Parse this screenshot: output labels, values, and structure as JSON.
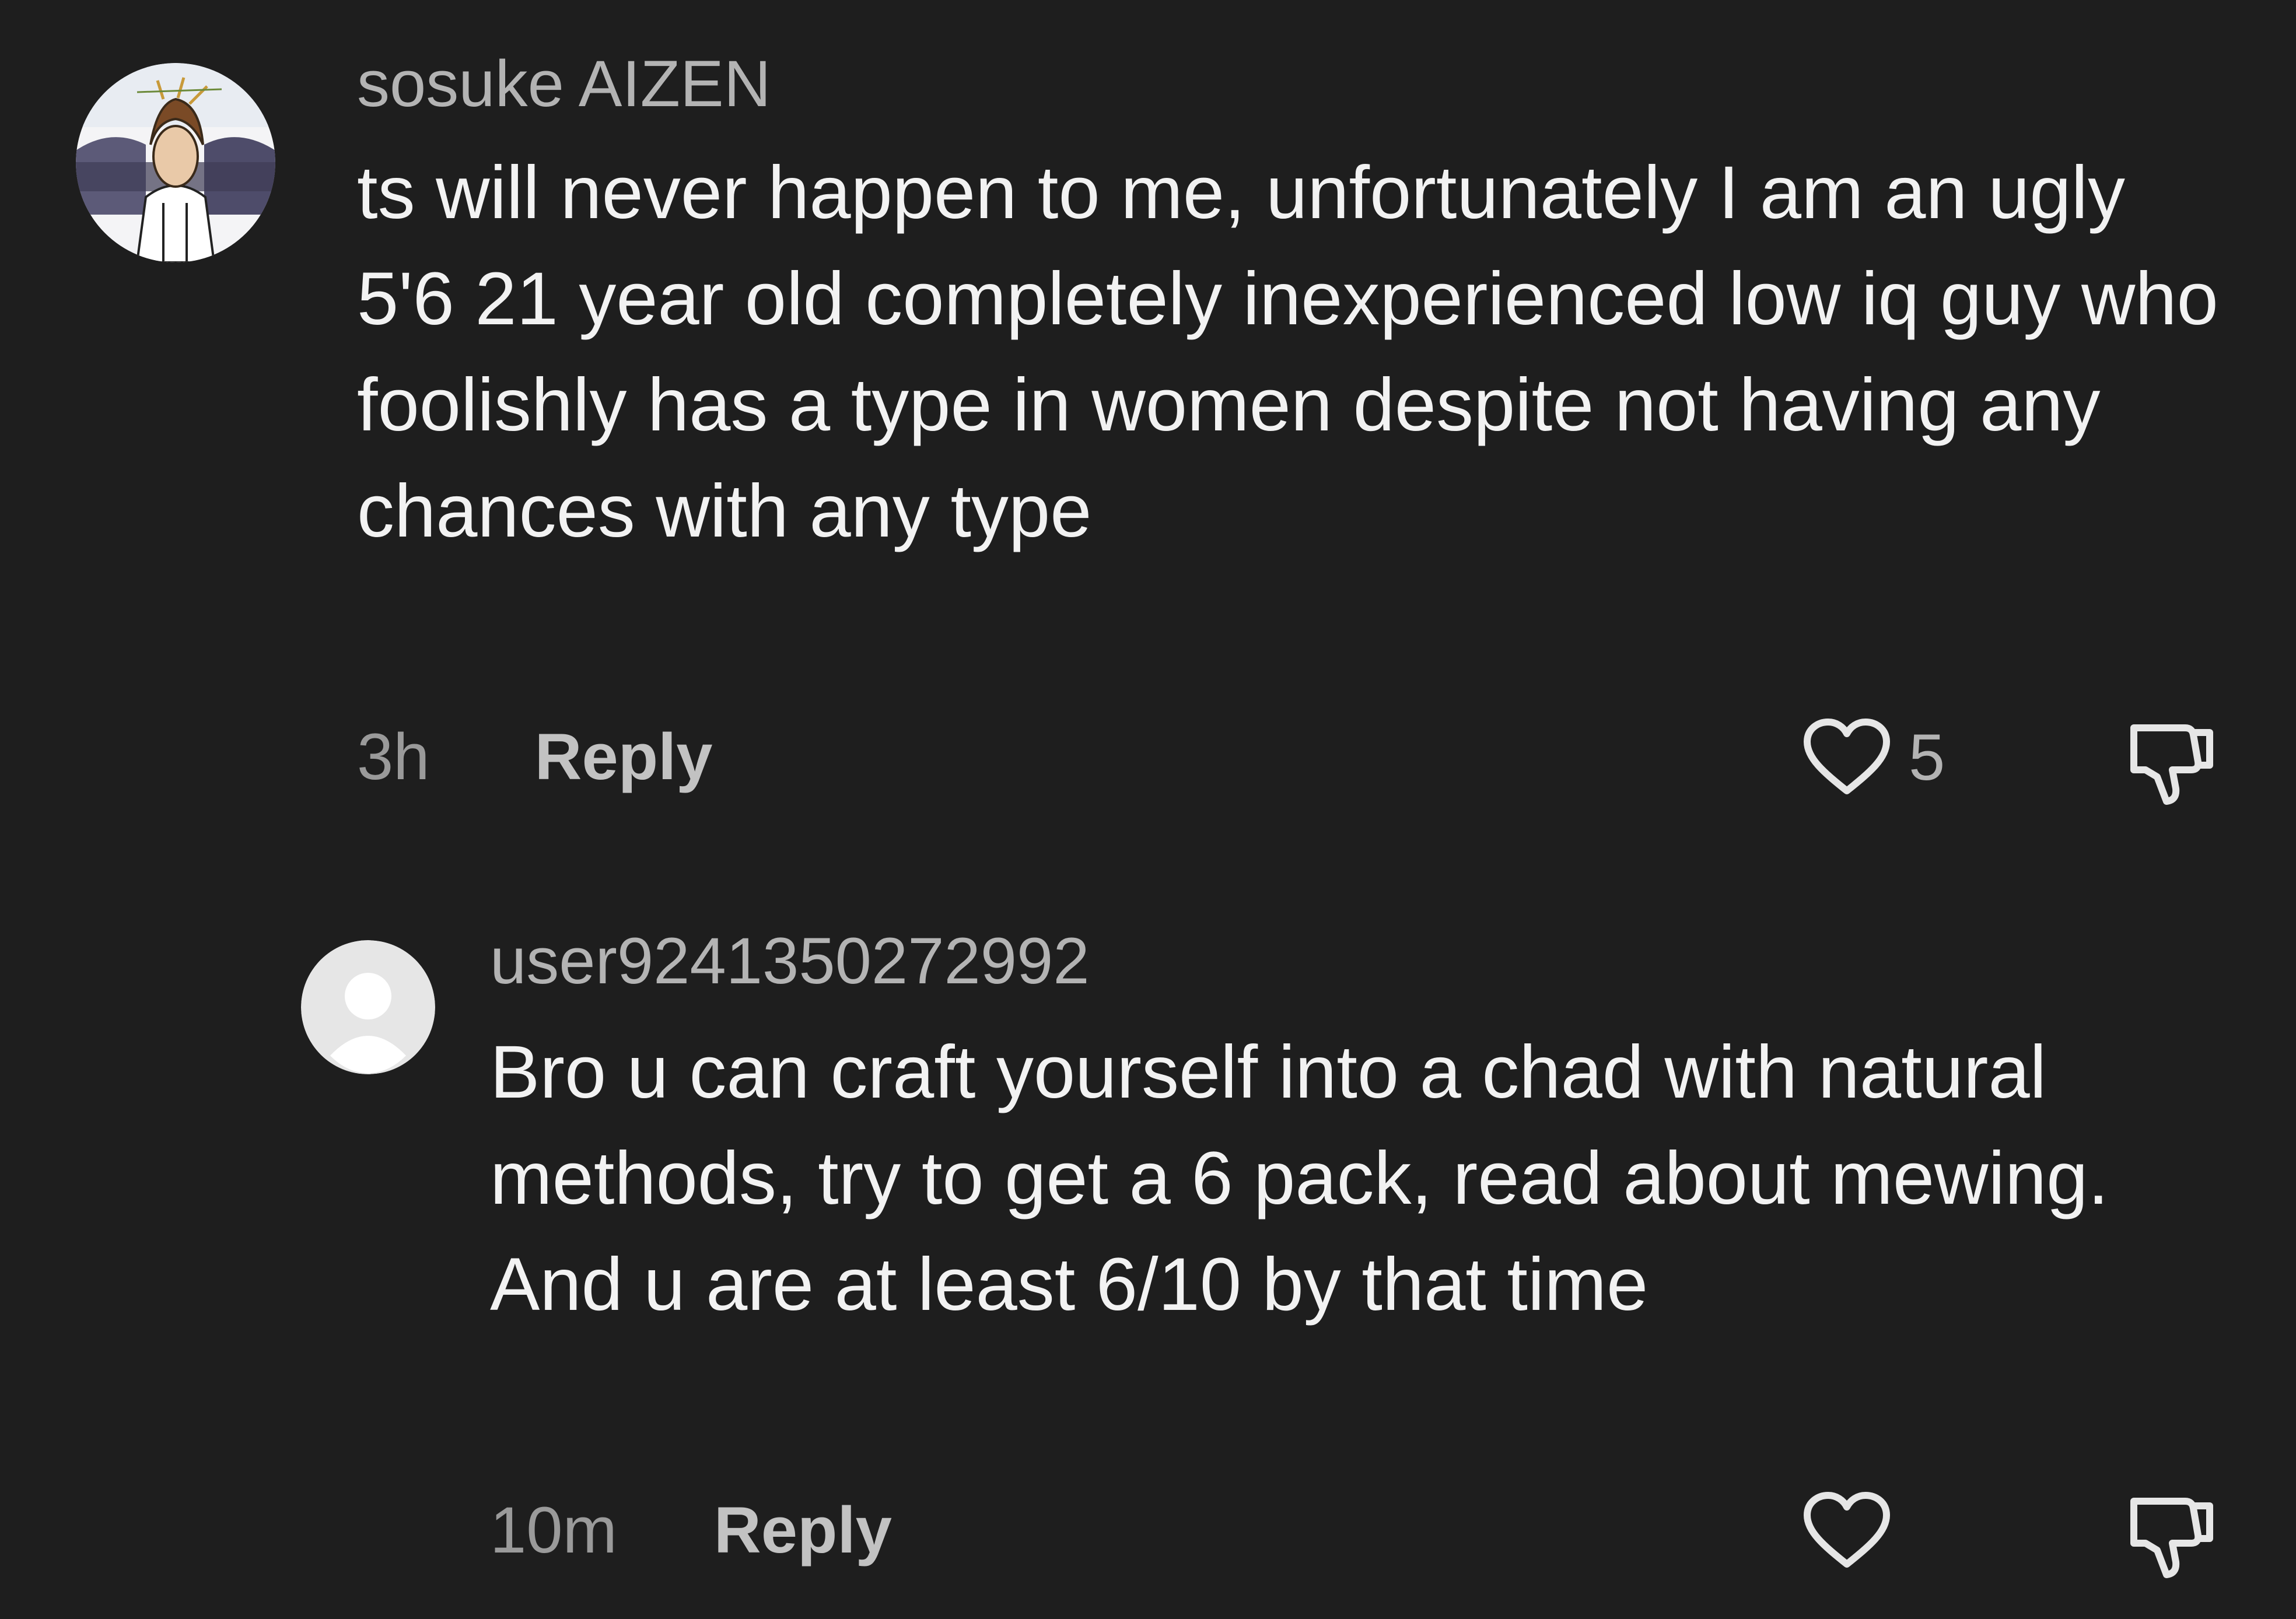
{
  "comments": [
    {
      "username": "sosuke AIZEN",
      "text": "ts will never happen to me, unfortunately I am an ugly 5'6 21 year old completely inexperienced low iq guy who foolishly has a type in women despite not having any chances with any type",
      "time": "3h",
      "reply_label": "Reply",
      "like_count": "5",
      "avatar_icon": "anime-character-avatar",
      "like_icon": "heart-icon",
      "dislike_icon": "thumbs-down-icon"
    },
    {
      "username": "user9241350272992",
      "text": "Bro u can craft yourself into a chad with natural methods, try to get a 6 pack, read about mewing. And u are at least 6/10 by that time",
      "time": "10m",
      "reply_label": "Reply",
      "avatar_icon": "default-user-avatar",
      "like_icon": "heart-icon",
      "dislike_icon": "thumbs-down-icon"
    }
  ],
  "colors": {
    "background": "#1e1e1e",
    "primary_text": "#f2f2f2",
    "secondary_text": "#b3b3b3"
  }
}
